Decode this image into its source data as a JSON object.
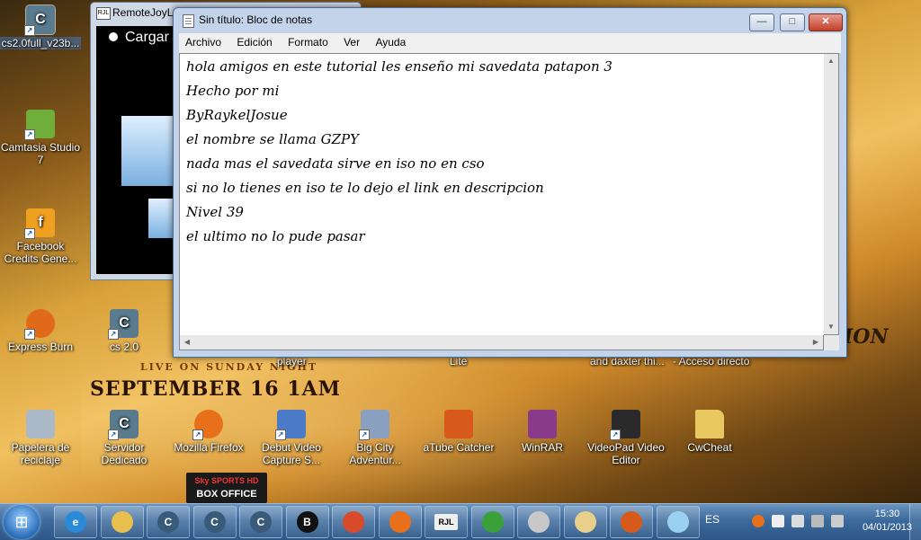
{
  "desktop": {
    "icons": [
      {
        "label": "cs2.0full_v23b...",
        "icon": "counter-strike-icon",
        "color": "#5a7a8e"
      },
      {
        "label": "Camtasia Studio 7",
        "icon": "camtasia-icon",
        "color": "#6fae3a"
      },
      {
        "label": "Facebook Credits Gene...",
        "icon": "facebook-icon",
        "color": "#f0a020"
      },
      {
        "label": "Express Burn",
        "icon": "express-burn-icon",
        "color": "#e06a1a"
      },
      {
        "label": "cs 2.0",
        "icon": "counter-strike-icon",
        "color": "#5a7a8e"
      },
      {
        "label": "Papelera de reciclaje",
        "icon": "recycle-bin-icon",
        "color": "#aab8c8"
      },
      {
        "label": "Servidor Dedicado",
        "icon": "counter-strike-icon",
        "color": "#5a7a8e"
      },
      {
        "label": "Mozilla Firefox",
        "icon": "firefox-icon",
        "color": "#e8701a"
      },
      {
        "label": "Debut Video Capture S...",
        "icon": "debut-icon",
        "color": "#4a7ac8"
      },
      {
        "label": "Big City Adventur...",
        "icon": "big-city-icon",
        "color": "#8aa0c0"
      },
      {
        "label": "aTube Catcher",
        "icon": "atube-icon",
        "color": "#d85a1a"
      },
      {
        "label": "WinRAR",
        "icon": "winrar-icon",
        "color": "#8a3a8a"
      },
      {
        "label": "VideoPad Video Editor",
        "icon": "videopad-icon",
        "color": "#2a2a2a"
      },
      {
        "label": "CwCheat",
        "icon": "folder-icon",
        "color": "#e8c860"
      }
    ],
    "partial_labels": [
      "player",
      "Lite",
      "and daxter thi...",
      "- Acceso directo"
    ],
    "wallpaper": {
      "live_text": "LIVE ON SUNDAY NIGHT",
      "date_text": "SEPTEMBER 16 1AM",
      "brand_text": "ION",
      "badge_top": "Sky SPORTS HD",
      "badge_bottom": "BOX OFFICE"
    }
  },
  "remotejoy": {
    "title": "RemoteJoyL",
    "icon_text": "RJL",
    "screen_text": "Cargar"
  },
  "notepad": {
    "title": "Sin título: Bloc de notas",
    "menu": [
      "Archivo",
      "Edición",
      "Formato",
      "Ver",
      "Ayuda"
    ],
    "lines": [
      "hola amigos en este tutorial les enseño mi savedata patapon 3",
      "Hecho por mi",
      "ByRaykelJosue",
      "el nombre se llama GZPY",
      "nada mas el savedata sirve en iso no en cso",
      "si no lo tienes en iso te lo dejo el link en descripcion",
      "Nivel 39",
      "el ultimo no lo pude pasar"
    ]
  },
  "taskbar": {
    "items": [
      {
        "name": "internet-explorer-icon",
        "color": "#2a8ad8",
        "glyph": "e"
      },
      {
        "name": "file-explorer-icon",
        "color": "#e8c050",
        "glyph": ""
      },
      {
        "name": "cs-server-icon-1",
        "color": "#3a5a7a",
        "glyph": "C"
      },
      {
        "name": "cs-server-icon-2",
        "color": "#3a5a7a",
        "glyph": "C"
      },
      {
        "name": "cs-server-icon-3",
        "color": "#3a5a7a",
        "glyph": "C"
      },
      {
        "name": "blackberry-icon",
        "color": "#111111",
        "glyph": "B"
      },
      {
        "name": "chrome-icon",
        "color": "#d84a2a",
        "glyph": ""
      },
      {
        "name": "firefox-icon",
        "color": "#e8701a",
        "glyph": ""
      },
      {
        "name": "remotejoy-icon",
        "color": "#eeeeee",
        "glyph": "RJL"
      },
      {
        "name": "messenger-icon",
        "color": "#3aa03a",
        "glyph": ""
      },
      {
        "name": "disc-icon",
        "color": "#c8c8c8",
        "glyph": ""
      },
      {
        "name": "paint-icon",
        "color": "#e8d08a",
        "glyph": ""
      },
      {
        "name": "atube-icon",
        "color": "#d85a1a",
        "glyph": ""
      },
      {
        "name": "notepad-icon",
        "color": "#9ad0f0",
        "glyph": ""
      }
    ],
    "language": "ES",
    "time": "15:30",
    "date": "04/01/2013"
  }
}
